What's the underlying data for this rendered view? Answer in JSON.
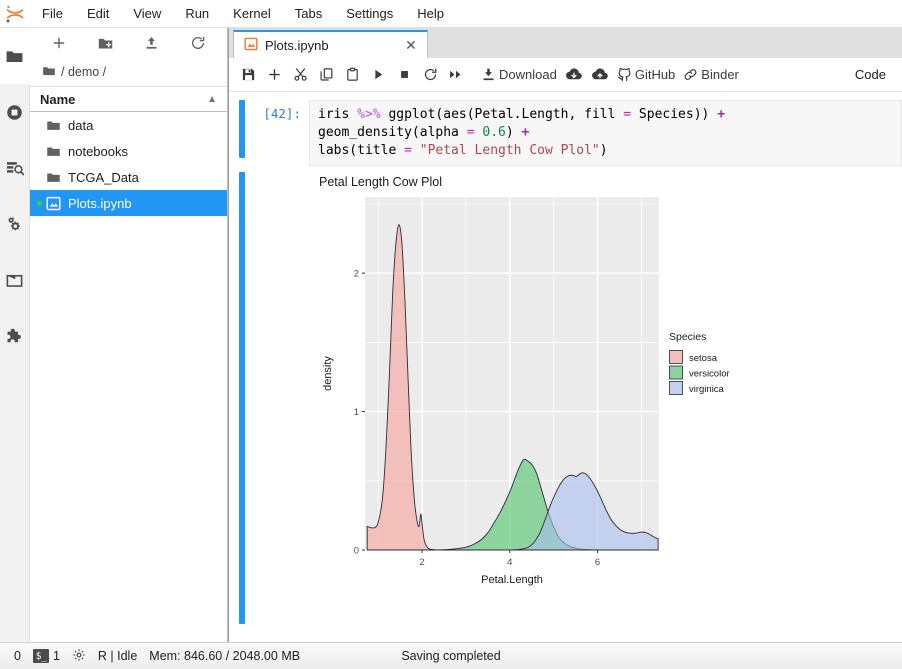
{
  "app": {
    "logo_icon": "jupyter-logo-icon",
    "menus": [
      "File",
      "Edit",
      "View",
      "Run",
      "Kernel",
      "Tabs",
      "Settings",
      "Help"
    ]
  },
  "activity_bar": {
    "items": [
      {
        "name": "file-browser-icon",
        "icon": "folder-icon",
        "active": true
      },
      {
        "name": "running-terminals-icon",
        "icon": "stop-circle-icon",
        "active": false
      },
      {
        "name": "command-palette-icon",
        "icon": "palette-search-icon",
        "active": false
      },
      {
        "name": "kernels-icon",
        "icon": "gears-icon",
        "active": false
      },
      {
        "name": "open-tabs-icon",
        "icon": "window-icon",
        "active": false
      },
      {
        "name": "extension-manager-icon",
        "icon": "puzzle-icon",
        "active": false
      }
    ]
  },
  "file_browser": {
    "toolbar": [
      {
        "name": "new-launcher-button",
        "icon": "plus-icon"
      },
      {
        "name": "new-folder-button",
        "icon": "folder-plus-icon"
      },
      {
        "name": "upload-button",
        "icon": "upload-arrow-icon"
      },
      {
        "name": "refresh-button",
        "icon": "refresh-icon"
      }
    ],
    "breadcrumb": {
      "home_icon": "folder-icon",
      "path": "/ demo /"
    },
    "column_header": "Name",
    "sort_caret": "▲",
    "items": [
      {
        "label": "data",
        "type": "folder",
        "selected": false,
        "running": false
      },
      {
        "label": "notebooks",
        "type": "folder",
        "selected": false,
        "running": false
      },
      {
        "label": "TCGA_Data",
        "type": "folder",
        "selected": false,
        "running": false
      },
      {
        "label": "Plots.ipynb",
        "type": "notebook",
        "selected": true,
        "running": true
      }
    ]
  },
  "dock": {
    "tab": {
      "icon": "notebook-icon",
      "label": "Plots.ipynb",
      "close_glyph": "✕"
    }
  },
  "notebook_toolbar": {
    "buttons": [
      {
        "name": "save-button",
        "icon": "save-icon",
        "label": ""
      },
      {
        "name": "insert-cell-button",
        "icon": "plus-icon",
        "label": ""
      },
      {
        "name": "cut-cell-button",
        "icon": "scissors-icon",
        "label": ""
      },
      {
        "name": "copy-cell-button",
        "icon": "copy-icon",
        "label": ""
      },
      {
        "name": "paste-cell-button",
        "icon": "paste-icon",
        "label": ""
      },
      {
        "name": "run-cell-button",
        "icon": "play-icon",
        "label": ""
      },
      {
        "name": "interrupt-button",
        "icon": "stop-square-icon",
        "label": ""
      },
      {
        "name": "restart-kernel-button",
        "icon": "restart-icon",
        "label": ""
      },
      {
        "name": "restart-run-all-button",
        "icon": "fast-forward-icon",
        "label": ""
      },
      {
        "name": "download-button",
        "icon": "download-icon",
        "label": "Download"
      },
      {
        "name": "cloud-download-button",
        "icon": "cloud-download-icon",
        "label": ""
      },
      {
        "name": "cloud-upload-button",
        "icon": "cloud-upload-icon",
        "label": ""
      },
      {
        "name": "github-button",
        "icon": "github-icon",
        "label": "GitHub"
      },
      {
        "name": "binder-button",
        "icon": "link-icon",
        "label": "Binder"
      }
    ],
    "cell_type": "Code"
  },
  "cells": [
    {
      "prompt": "[42]:",
      "code_lines": [
        [
          {
            "t": "iris ",
            "c": "plain"
          },
          {
            "t": "%>%",
            "c": "pipe"
          },
          {
            "t": " ggplot(aes(Petal.Length, fill ",
            "c": "plain"
          },
          {
            "t": "=",
            "c": "eq"
          },
          {
            "t": " Species)) ",
            "c": "plain"
          },
          {
            "t": "+",
            "c": "plus"
          }
        ],
        [
          {
            "t": "geom_density(alpha ",
            "c": "plain"
          },
          {
            "t": "=",
            "c": "eq"
          },
          {
            "t": " ",
            "c": "plain"
          },
          {
            "t": "0.6",
            "c": "num"
          },
          {
            "t": ") ",
            "c": "plain"
          },
          {
            "t": "+",
            "c": "plus"
          }
        ],
        [
          {
            "t": "labs(title ",
            "c": "plain"
          },
          {
            "t": "=",
            "c": "eq"
          },
          {
            "t": " ",
            "c": "plain"
          },
          {
            "t": "\"Petal Length Cow Plol\"",
            "c": "str"
          },
          {
            "t": ")",
            "c": "plain"
          }
        ]
      ]
    }
  ],
  "chart_data": {
    "type": "area",
    "title": "Petal Length Cow Plol",
    "xlabel": "Petal.Length",
    "ylabel": "density",
    "xlim": [
      0.7,
      7.4
    ],
    "ylim": [
      0,
      2.55
    ],
    "xticks": [
      2,
      4,
      6
    ],
    "yticks": [
      0,
      1,
      2
    ],
    "grid": true,
    "alpha": 0.6,
    "legend": {
      "title": "Species",
      "position": "right",
      "entries": [
        {
          "label": "setosa",
          "color": "#F8A19A"
        },
        {
          "label": "versicolor",
          "color": "#4FC36B"
        },
        {
          "label": "virginica",
          "color": "#A8BFF0"
        }
      ]
    },
    "series": [
      {
        "name": "setosa",
        "color": "#F8A19A",
        "peak_x": 1.47,
        "peak_y": 2.35,
        "points": [
          [
            0.75,
            0.17
          ],
          [
            0.9,
            0.16
          ],
          [
            1.0,
            0.2
          ],
          [
            1.1,
            0.38
          ],
          [
            1.18,
            0.75
          ],
          [
            1.26,
            1.3
          ],
          [
            1.33,
            1.85
          ],
          [
            1.4,
            2.2
          ],
          [
            1.47,
            2.35
          ],
          [
            1.54,
            2.22
          ],
          [
            1.61,
            1.8
          ],
          [
            1.68,
            1.25
          ],
          [
            1.75,
            0.72
          ],
          [
            1.82,
            0.38
          ],
          [
            1.88,
            0.22
          ],
          [
            1.93,
            0.17
          ],
          [
            1.97,
            0.26
          ],
          [
            2.0,
            0.19
          ],
          [
            2.05,
            0.07
          ],
          [
            2.12,
            0.02
          ],
          [
            2.2,
            0.005
          ],
          [
            2.4,
            0.0
          ]
        ]
      },
      {
        "name": "versicolor",
        "color": "#4FC36B",
        "peak_x": 4.32,
        "peak_y": 0.655,
        "points": [
          [
            2.3,
            0.0
          ],
          [
            2.6,
            0.004
          ],
          [
            2.85,
            0.012
          ],
          [
            3.05,
            0.025
          ],
          [
            3.2,
            0.045
          ],
          [
            3.35,
            0.075
          ],
          [
            3.5,
            0.125
          ],
          [
            3.62,
            0.185
          ],
          [
            3.75,
            0.255
          ],
          [
            3.87,
            0.33
          ],
          [
            4.0,
            0.42
          ],
          [
            4.12,
            0.52
          ],
          [
            4.22,
            0.6
          ],
          [
            4.32,
            0.655
          ],
          [
            4.42,
            0.64
          ],
          [
            4.52,
            0.61
          ],
          [
            4.62,
            0.545
          ],
          [
            4.72,
            0.44
          ],
          [
            4.82,
            0.33
          ],
          [
            4.92,
            0.23
          ],
          [
            5.02,
            0.15
          ],
          [
            5.12,
            0.09
          ],
          [
            5.25,
            0.048
          ],
          [
            5.4,
            0.022
          ],
          [
            5.6,
            0.008
          ],
          [
            5.85,
            0.002
          ],
          [
            6.1,
            0.0
          ]
        ]
      },
      {
        "name": "virginica",
        "color": "#A8BFF0",
        "peak_x": 5.62,
        "peak_y": 0.555,
        "points": [
          [
            4.05,
            0.0
          ],
          [
            4.25,
            0.006
          ],
          [
            4.42,
            0.02
          ],
          [
            4.55,
            0.055
          ],
          [
            4.68,
            0.12
          ],
          [
            4.8,
            0.215
          ],
          [
            4.92,
            0.32
          ],
          [
            5.05,
            0.415
          ],
          [
            5.18,
            0.49
          ],
          [
            5.3,
            0.53
          ],
          [
            5.42,
            0.54
          ],
          [
            5.52,
            0.532
          ],
          [
            5.62,
            0.555
          ],
          [
            5.72,
            0.552
          ],
          [
            5.82,
            0.52
          ],
          [
            5.95,
            0.455
          ],
          [
            6.08,
            0.37
          ],
          [
            6.2,
            0.285
          ],
          [
            6.32,
            0.215
          ],
          [
            6.45,
            0.165
          ],
          [
            6.58,
            0.135
          ],
          [
            6.72,
            0.122
          ],
          [
            6.88,
            0.122
          ],
          [
            7.02,
            0.13
          ],
          [
            7.15,
            0.12
          ],
          [
            7.28,
            0.095
          ],
          [
            7.38,
            0.08
          ]
        ]
      }
    ]
  },
  "status_bar": {
    "left_count": "0",
    "terminal_glyph": "$_",
    "kernel_count": "1",
    "gear_icon": "gear-icon",
    "kernel_status": "R | Idle",
    "memory": "Mem: 846.60 / 2048.00 MB",
    "message": "Saving completed"
  }
}
